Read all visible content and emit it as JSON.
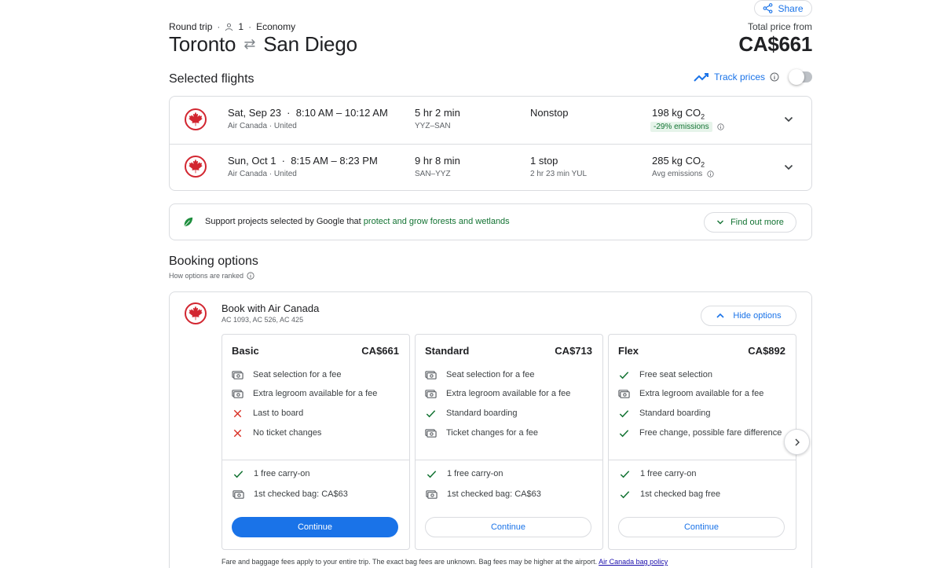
{
  "header": {
    "share_label": "Share",
    "trip_type": "Round trip",
    "passengers": "1",
    "cabin": "Economy",
    "origin": "Toronto",
    "destination": "San Diego",
    "total_label": "Total price from",
    "total_price": "CA$661"
  },
  "selected": {
    "title": "Selected flights",
    "track_label": "Track prices",
    "track_enabled": false,
    "flights": [
      {
        "date": "Sat, Sep 23",
        "times": "8:10 AM – 10:12 AM",
        "airlines": "Air Canada · United",
        "duration": "5 hr 2 min",
        "route": "YYZ–SAN",
        "stops": "Nonstop",
        "stop_detail": "",
        "co2": "198 kg CO",
        "co2_sub": "2",
        "emissions": "-29% emissions"
      },
      {
        "date": "Sun, Oct 1",
        "times": "8:15 AM – 8:23 PM",
        "airlines": "Air Canada · United",
        "duration": "9 hr 8 min",
        "route": "SAN–YYZ",
        "stops": "1 stop",
        "stop_detail": "2 hr 23 min YUL",
        "co2": "285 kg CO",
        "co2_sub": "2",
        "emissions": "Avg emissions"
      }
    ]
  },
  "forest": {
    "text": "Support projects selected by Google that ",
    "link": "protect and grow forests and wetlands",
    "button": "Find out more"
  },
  "booking": {
    "title": "Booking options",
    "ranked": "How options are ranked",
    "provider": "Book with Air Canada",
    "flight_codes": "AC 1093, AC 526, AC 425",
    "hide_label": "Hide options",
    "fares": [
      {
        "name": "Basic",
        "price": "CA$661",
        "features": [
          {
            "icon": "fee-icon",
            "text": "Seat selection for a fee"
          },
          {
            "icon": "fee-icon",
            "text": "Extra legroom available for a fee"
          },
          {
            "icon": "x-icon",
            "text": "Last to board"
          },
          {
            "icon": "x-icon",
            "text": "No ticket changes"
          }
        ],
        "bags": [
          {
            "icon": "check-icon",
            "text": "1 free carry-on"
          },
          {
            "icon": "fee-icon",
            "text": "1st checked bag: CA$63"
          }
        ],
        "button": "Continue"
      },
      {
        "name": "Standard",
        "price": "CA$713",
        "features": [
          {
            "icon": "fee-icon",
            "text": "Seat selection for a fee"
          },
          {
            "icon": "fee-icon",
            "text": "Extra legroom available for a fee"
          },
          {
            "icon": "check-icon",
            "text": "Standard boarding"
          },
          {
            "icon": "fee-icon",
            "text": "Ticket changes for a fee"
          }
        ],
        "bags": [
          {
            "icon": "check-icon",
            "text": "1 free carry-on"
          },
          {
            "icon": "fee-icon",
            "text": "1st checked bag: CA$63"
          }
        ],
        "button": "Continue"
      },
      {
        "name": "Flex",
        "price": "CA$892",
        "features": [
          {
            "icon": "check-icon",
            "text": "Free seat selection"
          },
          {
            "icon": "fee-icon",
            "text": "Extra legroom available for a fee"
          },
          {
            "icon": "check-icon",
            "text": "Standard boarding"
          },
          {
            "icon": "check-icon",
            "text": "Free change, possible fare difference"
          }
        ],
        "bags": [
          {
            "icon": "check-icon",
            "text": "1 free carry-on"
          },
          {
            "icon": "check-icon",
            "text": "1st checked bag free"
          }
        ],
        "button": "Continue"
      }
    ],
    "footnote": "Fare and baggage fees apply to your entire trip. The exact bag fees are unknown. Bag fees may be higher at the airport. ",
    "footnote_link": "Air Canada bag policy"
  },
  "colors": {
    "accent": "#1a73e8",
    "green": "#137333",
    "red": "#d93025",
    "border": "#dadce0"
  }
}
